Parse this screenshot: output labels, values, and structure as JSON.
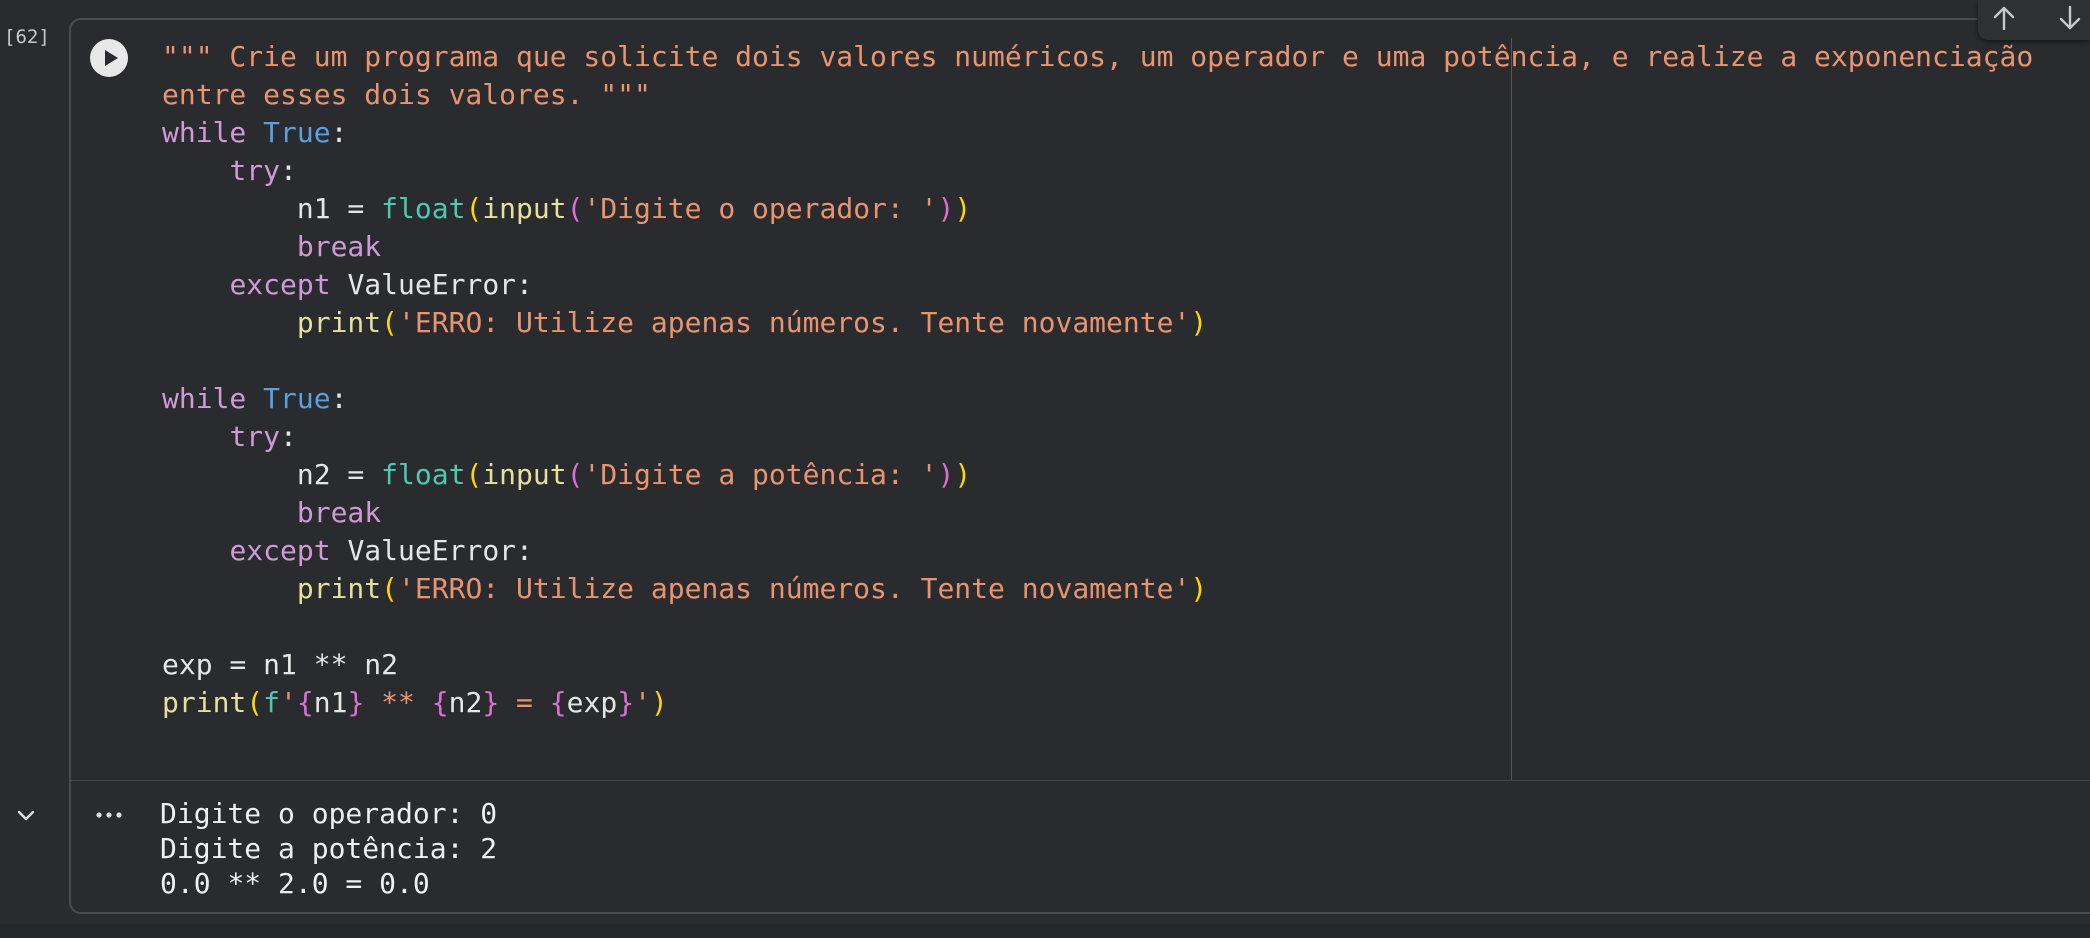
{
  "cell": {
    "execution_count": "[62]"
  },
  "toolbar": {
    "icons": [
      "arrow-up-icon",
      "arrow-down-icon"
    ]
  },
  "code": {
    "l1": "\"\"\" Crie um programa que solicite dois valores numéricos, um operador e uma potência, e realize a exponenciação",
    "l2": "entre esses dois valores. \"\"\"",
    "kw_while": "while",
    "const_true": "True",
    "colon": ":",
    "kw_try": "try",
    "assign_n1": "n1 = ",
    "assign_n2": "n2 = ",
    "fn_float": "float",
    "fn_input": "input",
    "fn_print": "print",
    "paren_open": "(",
    "paren_close": ")",
    "str_prompt1": "'Digite o operador: '",
    "str_prompt2": "'Digite a potência: '",
    "kw_break": "break",
    "kw_except": "except",
    "exc_value_error": "ValueError:",
    "str_error": "'ERRO: Utilize apenas números. Tente novamente'",
    "exp_line": "exp = n1 ** n2",
    "fprefix": "f",
    "quote": "'",
    "brace_open": "{",
    "brace_close": "}",
    "var_n1": "n1",
    "var_n2": "n2",
    "var_exp": "exp",
    "fmt_op": " ** ",
    "fmt_eq": " = "
  },
  "output": {
    "lines": [
      "Digite o operador: 0",
      "Digite a potência: 2",
      "0.0 ** 2.0 = 0.0"
    ]
  },
  "colors": {
    "background": "#2a2b2f",
    "string": "#e8956f",
    "keyword": "#cf9ad6",
    "constant": "#5b9fde",
    "builtin": "#4ec9b0",
    "function": "#e4e19c",
    "bracket_level1": "#ffd700",
    "bracket_level2": "#da70d6"
  }
}
